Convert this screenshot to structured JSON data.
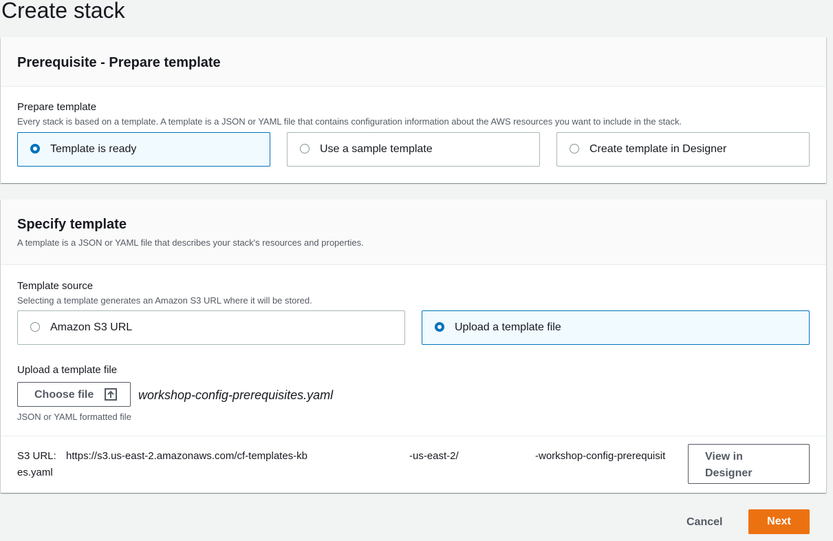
{
  "page": {
    "title": "Create stack"
  },
  "prepare": {
    "heading": "Prerequisite - Prepare template",
    "field_label": "Prepare template",
    "field_desc": "Every stack is based on a template. A template is a JSON or YAML file that contains configuration information about the AWS resources you want to include in the stack.",
    "options": [
      {
        "label": "Template is ready",
        "selected": true
      },
      {
        "label": "Use a sample template",
        "selected": false
      },
      {
        "label": "Create template in Designer",
        "selected": false
      }
    ]
  },
  "specify": {
    "heading": "Specify template",
    "desc": "A template is a JSON or YAML file that describes your stack's resources and properties.",
    "source_label": "Template source",
    "source_desc": "Selecting a template generates an Amazon S3 URL where it will be stored.",
    "options": [
      {
        "label": "Amazon S3 URL",
        "selected": false
      },
      {
        "label": "Upload a template file",
        "selected": true
      }
    ],
    "upload_label": "Upload a template file",
    "choose_file_label": "Choose file",
    "file_name": "workshop-config-prerequisites.yaml",
    "file_hint": "JSON or YAML formatted file",
    "s3_label": "S3 URL:",
    "s3_url_part1": "https://s3.us-east-2.amazonaws.com/cf-templates-kb",
    "s3_url_part2": "-us-east-2/",
    "s3_url_part3": "-workshop-config-prerequisit",
    "s3_url_part4": "es.yaml",
    "view_designer_label": "View in Designer"
  },
  "footer": {
    "cancel_label": "Cancel",
    "next_label": "Next"
  },
  "colors": {
    "accent": "#0073bb",
    "primary_button": "#ec7211",
    "selected_tile_bg": "#f1faff"
  },
  "icons": {
    "upload": "upload-arrow-icon"
  }
}
